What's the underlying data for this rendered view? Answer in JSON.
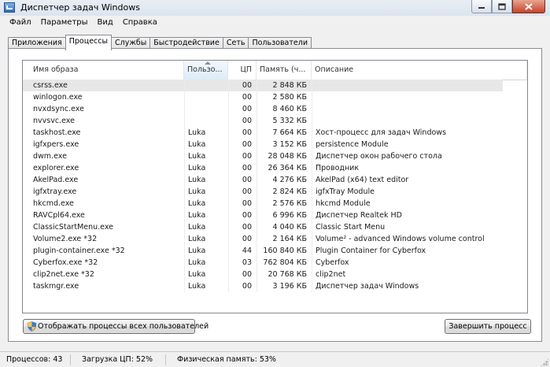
{
  "window": {
    "title": "Диспетчер задач Windows"
  },
  "menu": [
    "Файл",
    "Параметры",
    "Вид",
    "Справка"
  ],
  "tabs": [
    "Приложения",
    "Процессы",
    "Службы",
    "Быстродействие",
    "Сеть",
    "Пользователи"
  ],
  "active_tab": "Процессы",
  "table": {
    "columns": [
      "Имя образа",
      "Пользо...",
      "ЦП",
      "Память (ч...",
      "Описание"
    ],
    "sorted_column": "Пользо...",
    "rows": [
      {
        "name": "csrss.exe",
        "user": "",
        "cpu": "00",
        "mem": "2 848 КБ",
        "desc": ""
      },
      {
        "name": "winlogon.exe",
        "user": "",
        "cpu": "00",
        "mem": "2 580 КБ",
        "desc": ""
      },
      {
        "name": "nvxdsync.exe",
        "user": "",
        "cpu": "00",
        "mem": "8 460 КБ",
        "desc": ""
      },
      {
        "name": "nvvsvc.exe",
        "user": "",
        "cpu": "00",
        "mem": "5 332 КБ",
        "desc": ""
      },
      {
        "name": "taskhost.exe",
        "user": "Luka",
        "cpu": "00",
        "mem": "7 664 КБ",
        "desc": "Хост-процесс для задач Windows"
      },
      {
        "name": "igfxpers.exe",
        "user": "Luka",
        "cpu": "00",
        "mem": "3 152 КБ",
        "desc": "persistence Module"
      },
      {
        "name": "dwm.exe",
        "user": "Luka",
        "cpu": "00",
        "mem": "28 048 КБ",
        "desc": "Диспетчер окон рабочего стола"
      },
      {
        "name": "explorer.exe",
        "user": "Luka",
        "cpu": "00",
        "mem": "26 364 КБ",
        "desc": "Проводник"
      },
      {
        "name": "AkelPad.exe",
        "user": "Luka",
        "cpu": "00",
        "mem": "4 276 КБ",
        "desc": "AkelPad (x64) text editor"
      },
      {
        "name": "igfxtray.exe",
        "user": "Luka",
        "cpu": "00",
        "mem": "2 824 КБ",
        "desc": "igfxTray Module"
      },
      {
        "name": "hkcmd.exe",
        "user": "Luka",
        "cpu": "00",
        "mem": "2 576 КБ",
        "desc": "hkcmd Module"
      },
      {
        "name": "RAVCpl64.exe",
        "user": "Luka",
        "cpu": "00",
        "mem": "6 996 КБ",
        "desc": "Диспетчер Realtek HD"
      },
      {
        "name": "ClassicStartMenu.exe",
        "user": "Luka",
        "cpu": "00",
        "mem": "4 040 КБ",
        "desc": "Classic Start Menu"
      },
      {
        "name": "Volume2.exe *32",
        "user": "Luka",
        "cpu": "00",
        "mem": "2 164 КБ",
        "desc": "Volume² - advanced Windows volume control"
      },
      {
        "name": "plugin-container.exe *32",
        "user": "Luka",
        "cpu": "44",
        "mem": "160 840 КБ",
        "desc": "Plugin Container for Cyberfox"
      },
      {
        "name": "Cyberfox.exe *32",
        "user": "Luka",
        "cpu": "03",
        "mem": "762 804 КБ",
        "desc": "Cyberfox"
      },
      {
        "name": "clip2net.exe *32",
        "user": "Luka",
        "cpu": "00",
        "mem": "20 768 КБ",
        "desc": "clip2net"
      },
      {
        "name": "taskmgr.exe",
        "user": "Luka",
        "cpu": "00",
        "mem": "3 196 КБ",
        "desc": "Диспетчер задач Windows"
      }
    ],
    "selected_row": "csrss.exe"
  },
  "buttons": {
    "show_all": "Отображать процессы всех пользователей",
    "end_process": "Завершить процесс"
  },
  "status": {
    "processes": "Процессов: 43",
    "cpu": "Загрузка ЦП: 52%",
    "memory": "Физическая память: 53%"
  }
}
